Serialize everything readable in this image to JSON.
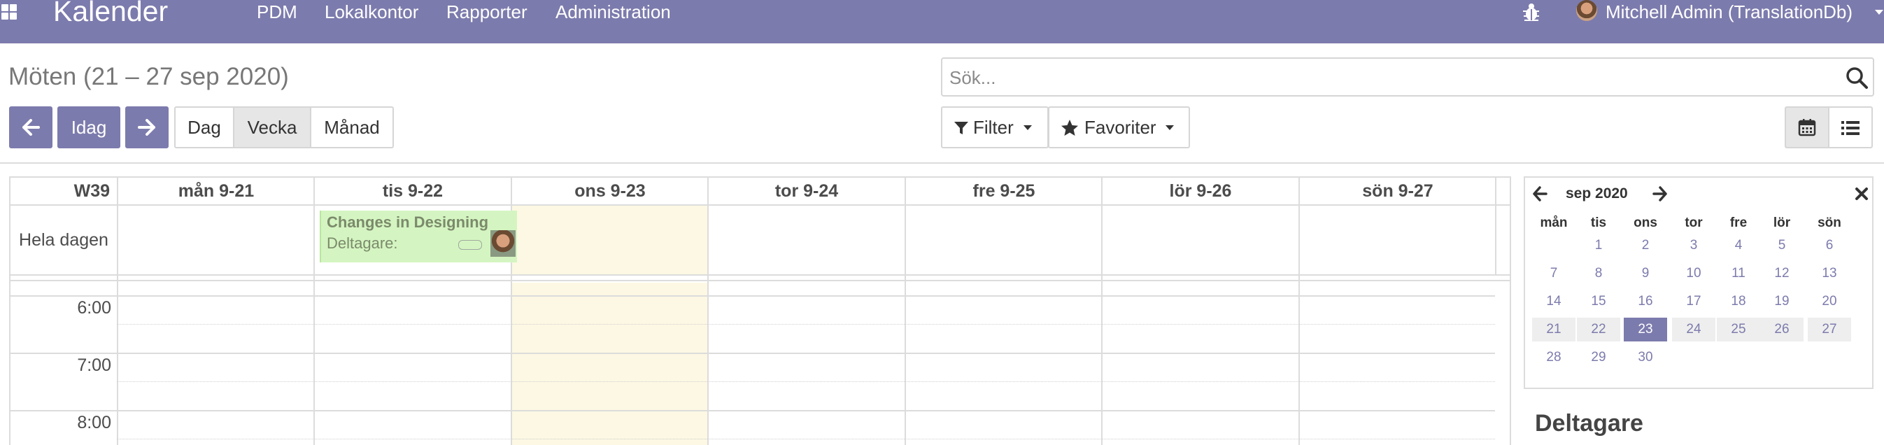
{
  "navbar": {
    "app_name": "Kalender",
    "menu": [
      "PDM",
      "Lokalkontor",
      "Rapporter",
      "Administration"
    ],
    "user": "Mitchell Admin (TranslationDb)",
    "icons": [
      "apps-icon",
      "bug-icon",
      "avatar",
      "caret-down-icon"
    ]
  },
  "control": {
    "title": "Möten (21 – 27 sep 2020)",
    "search_placeholder": "Sök...",
    "today_label": "Idag",
    "scales": [
      "Dag",
      "Vecka",
      "Månad"
    ],
    "active_scale": "Vecka",
    "filter_label": "Filter",
    "favorites_label": "Favoriter",
    "views": [
      "calendar",
      "list"
    ],
    "active_view": "calendar"
  },
  "calendar": {
    "week_label": "W39",
    "days": [
      "mån 9-21",
      "tis 9-22",
      "ons 9-23",
      "tor 9-24",
      "fre 9-25",
      "lör 9-26",
      "sön 9-27"
    ],
    "today_index": 2,
    "allday_label": "Hela dagen",
    "event": {
      "title": "Changes in Designing",
      "attendees_label": "Deltagare:"
    },
    "times": [
      "6:00",
      "7:00",
      "8:00"
    ]
  },
  "sidebar": {
    "month_title": "sep 2020",
    "weekdays": [
      "mån",
      "tis",
      "ons",
      "tor",
      "fre",
      "lör",
      "sön"
    ],
    "weeks": [
      [
        "",
        "1",
        "2",
        "3",
        "4",
        "5",
        "6"
      ],
      [
        "7",
        "8",
        "9",
        "10",
        "11",
        "12",
        "13"
      ],
      [
        "14",
        "15",
        "16",
        "17",
        "18",
        "19",
        "20"
      ],
      [
        "21",
        "22",
        "23",
        "24",
        "25",
        "26",
        "27"
      ],
      [
        "28",
        "29",
        "30",
        "",
        "",
        "",
        ""
      ]
    ],
    "selected_day": "23",
    "attendees_title": "Deltagare"
  },
  "colors": {
    "brand": "#7c7bad",
    "today": "#fcf8e3",
    "event": "#d4f5c1"
  }
}
